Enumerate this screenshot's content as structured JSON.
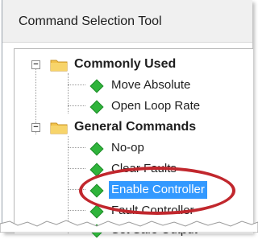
{
  "window": {
    "title": "Command Selection Tool"
  },
  "tree": {
    "groups": [
      {
        "label": "Commonly Used",
        "expander": "−",
        "items": [
          "Move Absolute",
          "Open Loop Rate"
        ]
      },
      {
        "label": "General Commands",
        "expander": "−",
        "items": [
          "No-op",
          "Clear Faults",
          "Enable Controller",
          "Fault Controller",
          "Set Safe Output"
        ]
      }
    ],
    "selected_item": "Enable Controller"
  },
  "colors": {
    "selection": "#3399ff",
    "annotation_ring": "#c1272d",
    "item_icon": "#2fb43b",
    "folder": "#f2c24a"
  },
  "icons": {
    "group": "folder-icon",
    "item": "green-diamond-icon",
    "expander": "collapse-icon"
  }
}
